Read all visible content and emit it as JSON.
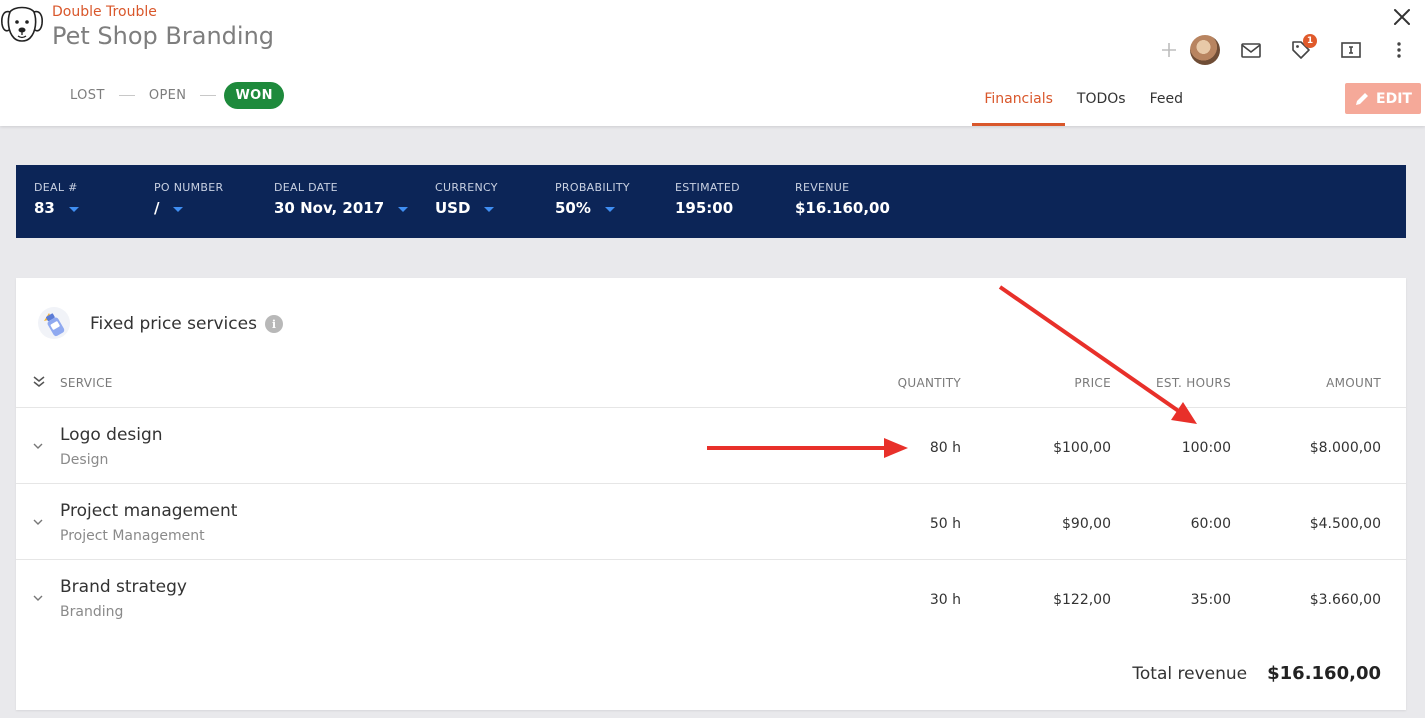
{
  "header": {
    "client": "Double Trouble",
    "title": "Pet Shop Branding",
    "stages": {
      "lost": "LOST",
      "open": "OPEN",
      "won": "WON"
    },
    "notifications_count": "1",
    "tabs": {
      "financials": "Financials",
      "todos": "TODOs",
      "feed": "Feed"
    },
    "edit_label": "EDIT",
    "icons": [
      "close-icon",
      "plus-icon",
      "avatar",
      "mail-icon",
      "tag-icon",
      "text-box-icon",
      "kebab-menu-icon",
      "pencil-icon"
    ]
  },
  "deal": {
    "fields": [
      {
        "label": "DEAL #",
        "value": "83"
      },
      {
        "label": "PO NUMBER",
        "value": "/"
      },
      {
        "label": "DEAL DATE",
        "value": "30 Nov, 2017"
      },
      {
        "label": "CURRENCY",
        "value": "USD"
      },
      {
        "label": "PROBABILITY",
        "value": "50%"
      },
      {
        "label": "ESTIMATED",
        "value": "195:00"
      },
      {
        "label": "REVENUE",
        "value": "$16.160,00"
      }
    ]
  },
  "services": {
    "title": "Fixed price services",
    "columns": {
      "service": "SERVICE",
      "quantity": "QUANTITY",
      "price": "PRICE",
      "hours": "EST. HOURS",
      "amount": "AMOUNT"
    },
    "rows": [
      {
        "name": "Logo design",
        "category": "Design",
        "quantity": "80 h",
        "price": "$100,00",
        "hours": "100:00",
        "amount": "$8.000,00"
      },
      {
        "name": "Project management",
        "category": "Project Management",
        "quantity": "50 h",
        "price": "$90,00",
        "hours": "60:00",
        "amount": "$4.500,00"
      },
      {
        "name": "Brand strategy",
        "category": "Branding",
        "quantity": "30 h",
        "price": "$122,00",
        "hours": "35:00",
        "amount": "$3.660,00"
      }
    ],
    "total_label": "Total revenue",
    "total_value": "$16.160,00"
  },
  "colors": {
    "accent": "#d9572b",
    "won": "#1e8a3c",
    "deal_bar": "#0c2557",
    "caret": "#3f8ef2",
    "annotation": "#e8302a"
  }
}
